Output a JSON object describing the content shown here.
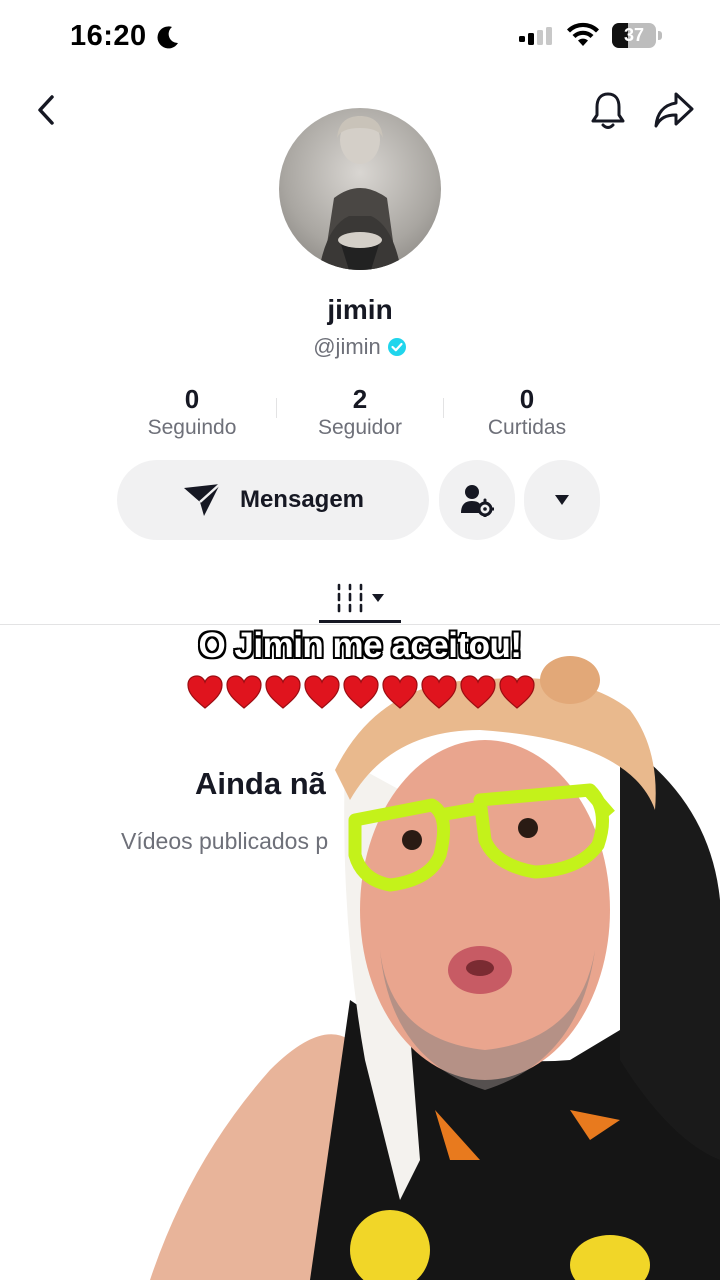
{
  "status_bar": {
    "time": "16:20",
    "battery": "37",
    "battery_level": 0.37,
    "icons": [
      "moon-icon",
      "signal-icon",
      "wifi-icon",
      "battery-icon"
    ]
  },
  "nav": {
    "icons": [
      "back-icon",
      "bell-icon",
      "share-icon"
    ]
  },
  "profile": {
    "username": "jimin",
    "handle": "@jimin",
    "verified_color": "#20d5ec"
  },
  "stats": [
    {
      "value": "0",
      "label": "Seguindo"
    },
    {
      "value": "2",
      "label": "Seguidor"
    },
    {
      "value": "0",
      "label": "Curtidas"
    }
  ],
  "actions": {
    "message_label": "Mensagem",
    "icons": [
      "send-icon",
      "add-friend-settings-icon",
      "caret-down-icon"
    ]
  },
  "tabs": {
    "active": "videos-tab",
    "icons": [
      "grid-lines-icon",
      "caret-down-icon"
    ]
  },
  "empty_state": {
    "title": "Ainda nã",
    "subtitle": "Vídeos publicados p"
  },
  "overlay": {
    "caption": "O Jimin me aceitou!",
    "hearts_count": 9,
    "heart_color": "#e0141e"
  }
}
